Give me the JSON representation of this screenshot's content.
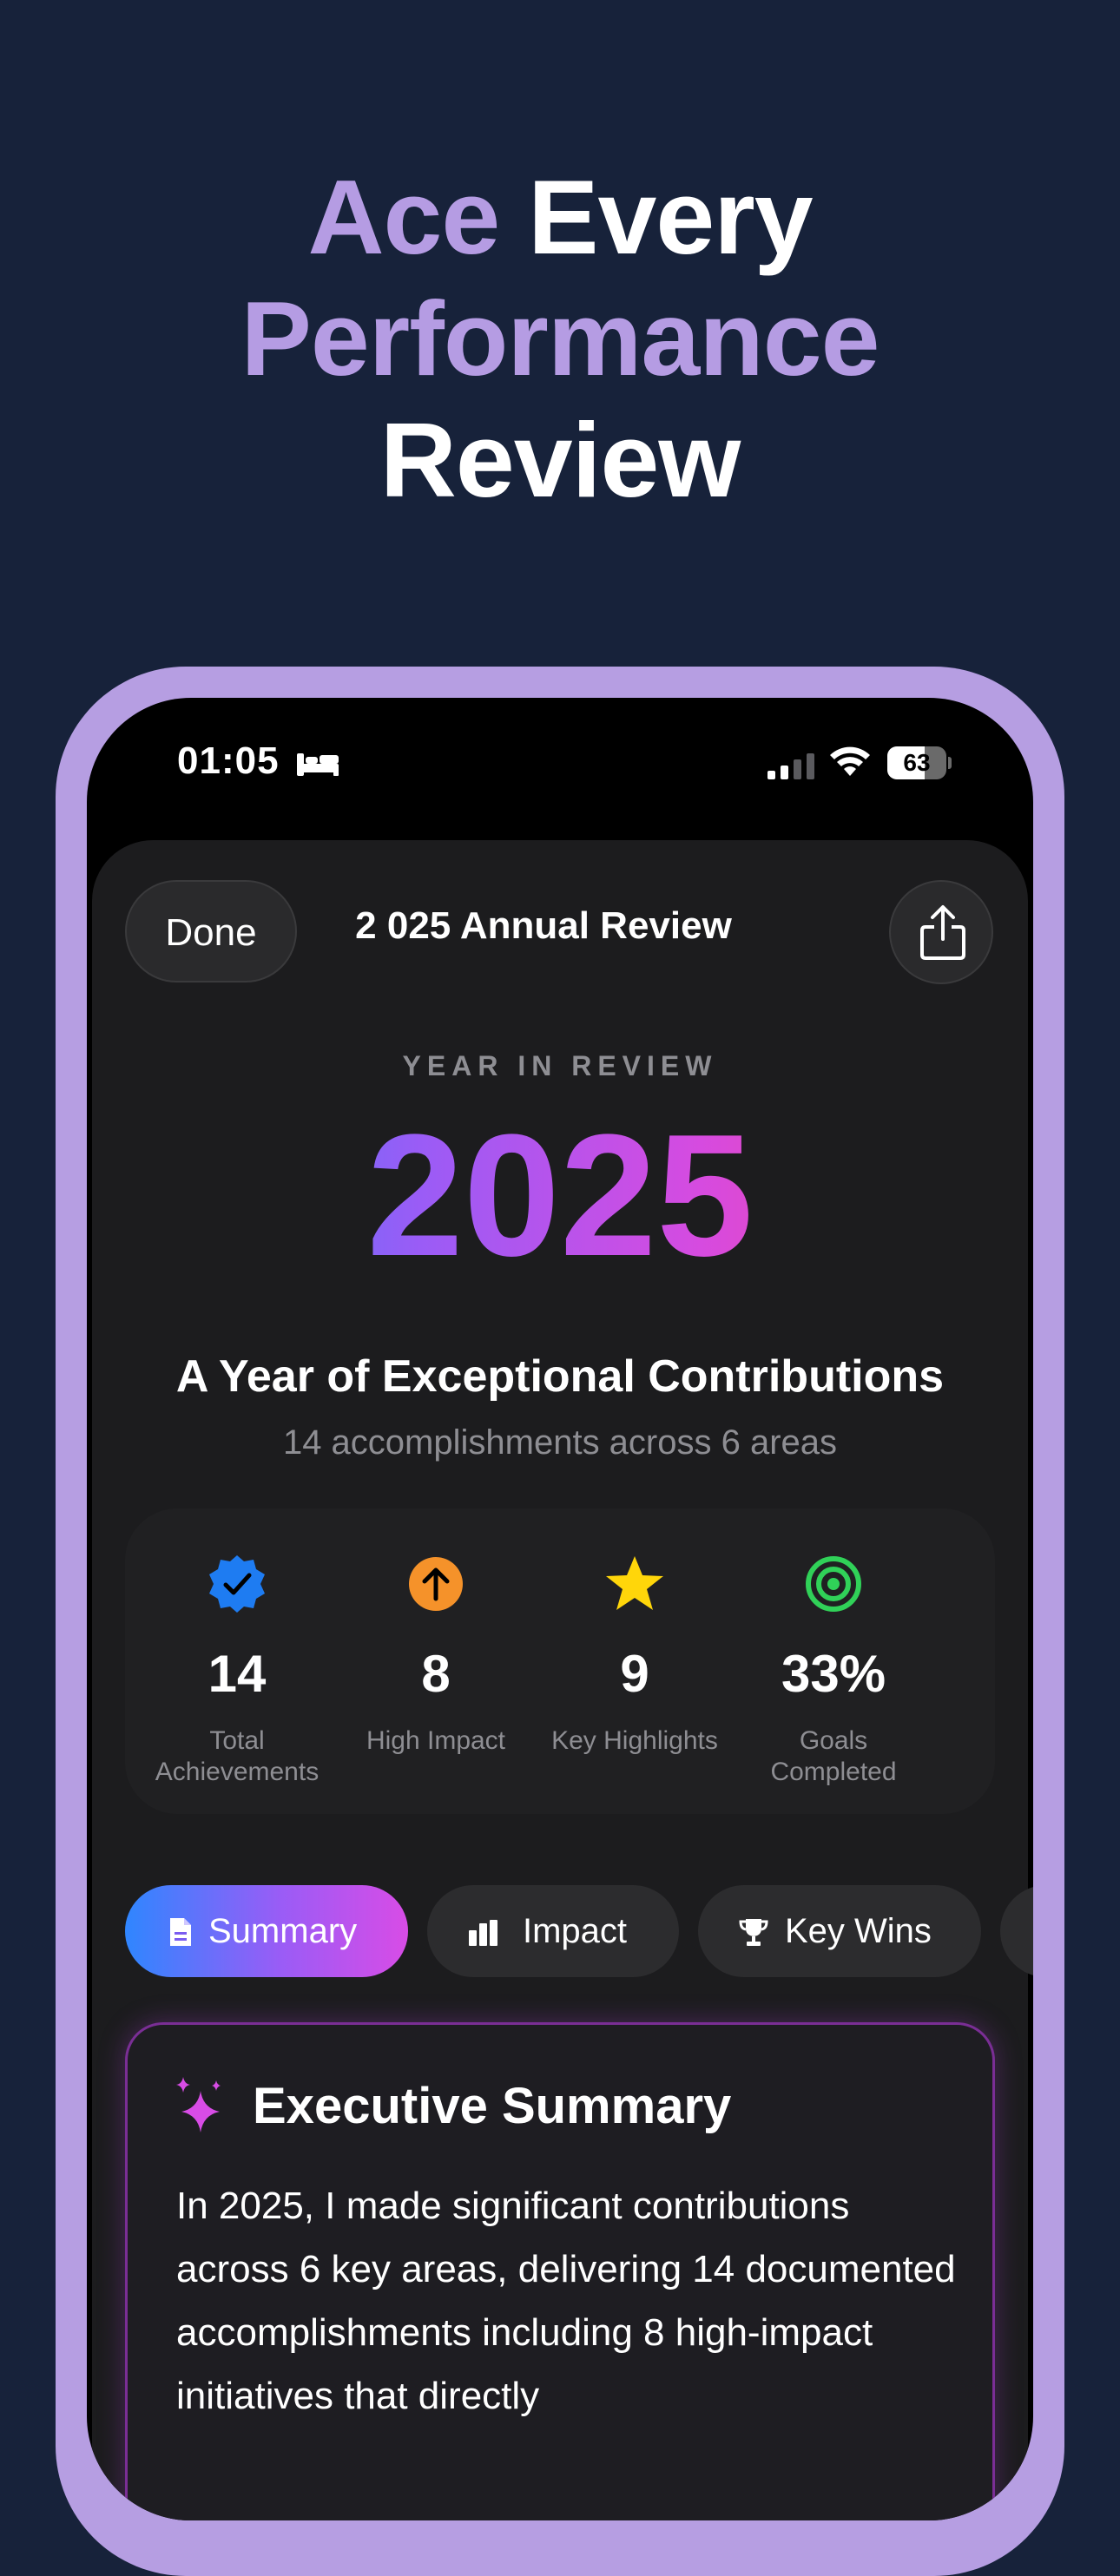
{
  "headline": {
    "line1_a": "Ace",
    "line1_b": "Every",
    "line2": "Performance",
    "line3": "Review"
  },
  "status_bar": {
    "time": "01:05",
    "battery_text": "63",
    "battery_level": 0.63,
    "focus_icon": "bed-icon"
  },
  "nav": {
    "done_label": "Done",
    "title": "2 025 Annual Review",
    "share_icon": "share-icon"
  },
  "hero": {
    "overline": "YEAR IN REVIEW",
    "year": "2025",
    "headline": "A Year of Exceptional Contributions",
    "subline": "14 accomplishments across 6 areas"
  },
  "stats": [
    {
      "icon": "verified-badge-icon",
      "value": "14",
      "label": "Total Achievements",
      "color": "#1e7cf2"
    },
    {
      "icon": "arrow-up-circle-icon",
      "value": "8",
      "label": "High Impact",
      "color": "#f5922a"
    },
    {
      "icon": "star-icon",
      "value": "9",
      "label": "Key Highlights",
      "color": "#ffd60a"
    },
    {
      "icon": "target-icon",
      "value": "33%",
      "label": "Goals Completed",
      "color": "#30d158"
    }
  ],
  "tabs": [
    {
      "label": "Summary",
      "icon": "document-icon",
      "active": true
    },
    {
      "label": "Impact",
      "icon": "bar-chart-icon",
      "active": false
    },
    {
      "label": "Key Wins",
      "icon": "trophy-icon",
      "active": false
    }
  ],
  "summary": {
    "title": "Executive Summary",
    "icon": "sparkles-icon",
    "body": "In 2025, I made significant contributions across 6 key areas, delivering 14 documented accomplishments including 8 high-impact initiatives that directly"
  },
  "colors": {
    "background": "#17223a",
    "frame": "#b69ee2",
    "accent_purple": "#b59ce3",
    "gradient_start": "#2f86ff",
    "gradient_end": "#ff3f88"
  }
}
